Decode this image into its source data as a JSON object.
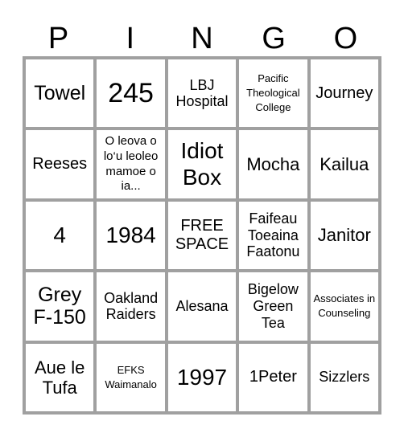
{
  "header": {
    "letters": [
      "P",
      "I",
      "N",
      "G",
      "O"
    ]
  },
  "grid": {
    "colors": {
      "border": "#a0a0a0",
      "cell": "#ffffff"
    },
    "cells": [
      [
        "Towel",
        "245",
        "LBJ Hospital",
        "Pacific Theological College",
        "Journey"
      ],
      [
        "Reeses",
        "O leova o lo‘u leoleo mamoe o ia...",
        "Idiot Box",
        "Mocha",
        "Kailua"
      ],
      [
        "4",
        "1984",
        "FREE SPACE",
        "Faifeau Toeaina Faatonu",
        "Janitor"
      ],
      [
        "Grey F-150",
        "Oakland Raiders",
        "Alesana",
        "Bigelow Green Tea",
        "Associates in Counseling"
      ],
      [
        "Aue le Tufa",
        "EFKS Waimanalo",
        "1997",
        "1Peter",
        "Sizzlers"
      ]
    ]
  }
}
